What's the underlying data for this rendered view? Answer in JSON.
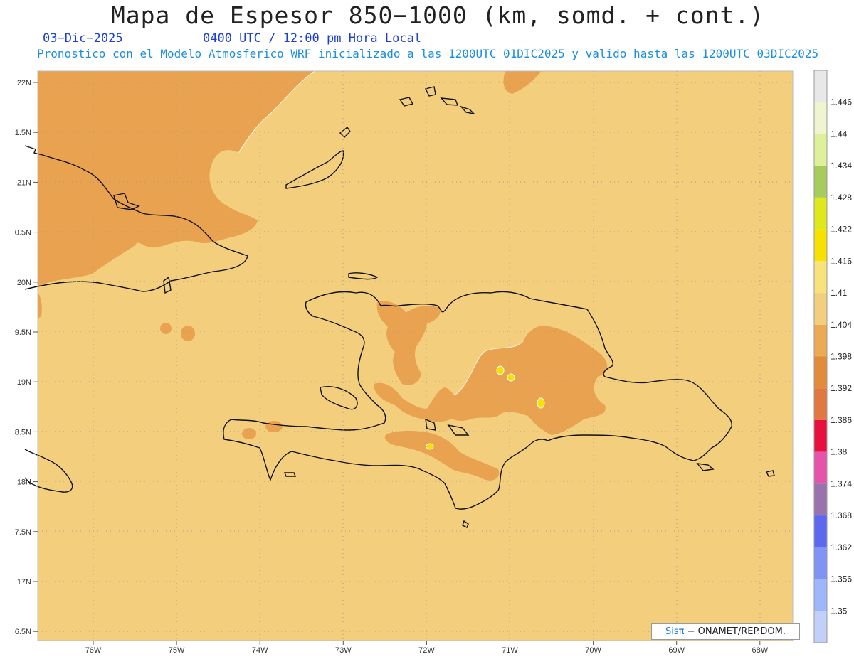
{
  "header": {
    "title": "Mapa de Espesor 850−1000 (km, somd. + cont.)",
    "date": "03−Dic−2025",
    "time": "0400 UTC / 12:00 pm Hora Local",
    "description": "Pronostico con el Modelo Atmosferico WRF inicializado a las 1200UTC_01DIC2025 y valido hasta las  1200UTC_03DIC2025"
  },
  "axes": {
    "lat_labels": [
      "22N",
      "1.5N",
      "21N",
      "0.5N",
      "20N",
      "9.5N",
      "19N",
      "8.5N",
      "18N",
      "7.5N",
      "17N",
      "6.5N"
    ],
    "lon_labels": [
      "76W",
      "75W",
      "74W",
      "73W",
      "72W",
      "71W",
      "70W",
      "69W",
      "68W"
    ]
  },
  "legend": {
    "levels": [
      "1.446",
      "1.44",
      "1.434",
      "1.428",
      "1.422",
      "1.416",
      "1.41",
      "1.404",
      "1.398",
      "1.392",
      "1.386",
      "1.38",
      "1.374",
      "1.368",
      "1.362",
      "1.356",
      "1.35"
    ],
    "colors": [
      "#e8e8e8",
      "#f0f5cf",
      "#dff09a",
      "#a6cc5c",
      "#dfe81a",
      "#f7e100",
      "#f9e27a",
      "#f3cf7d",
      "#ecaa53",
      "#e28c3a",
      "#e07840",
      "#e8103c",
      "#e653aa",
      "#9b72b0",
      "#5c68f0",
      "#8094f5",
      "#9eb6fa",
      "#c2cffb"
    ]
  },
  "credit": {
    "brand": "Sis",
    "pi": "π",
    "org": "− ONAMET/REP.DOM."
  },
  "colors": {
    "background_field": "#f3cf7d",
    "dark_field": "#e9a24f",
    "coast": "#111111",
    "grid": "#9a9a9a"
  }
}
